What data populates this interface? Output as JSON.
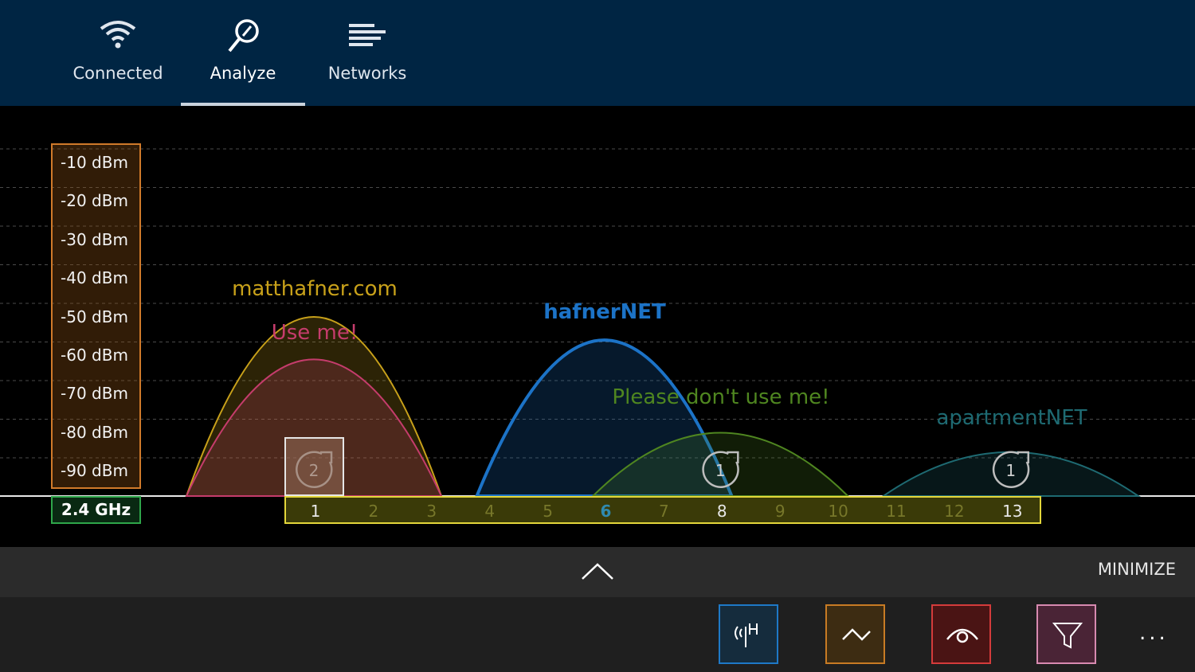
{
  "nav": {
    "tabs": [
      {
        "label": "Connected",
        "icon": "wifi-icon"
      },
      {
        "label": "Analyze",
        "icon": "magnifier-icon",
        "active": true
      },
      {
        "label": "Networks",
        "icon": "list-icon"
      }
    ]
  },
  "analyzer": {
    "dbm_labels": [
      "-10 dBm",
      "-20 dBm",
      "-30 dBm",
      "-40 dBm",
      "-50 dBm",
      "-60 dBm",
      "-70 dBm",
      "-80 dBm",
      "-90 dBm"
    ],
    "band": "2.4 GHz",
    "channels": [
      "1",
      "2",
      "3",
      "4",
      "5",
      "6",
      "7",
      "8",
      "9",
      "10",
      "11",
      "12",
      "13"
    ],
    "highlighted_channels": {
      "1": "#e8e8e8",
      "6": "#2f8ab0",
      "8": "#e8e8e8",
      "13": "#e8e8e8"
    },
    "networks": [
      {
        "name": "matthafner.com",
        "channel": 1,
        "signal_dbm": -50,
        "color": "#c8a11a"
      },
      {
        "name": "Use me!",
        "channel": 1,
        "signal_dbm": -61,
        "color": "#c53c6c"
      },
      {
        "name": "hafnerNET",
        "channel": 6,
        "signal_dbm": -56,
        "color": "#1c73c7",
        "bold": true
      },
      {
        "name": "Please don't use me!",
        "channel": 8,
        "signal_dbm": -80,
        "color": "#4f8620"
      },
      {
        "name": "apartmentNET",
        "channel": 13,
        "signal_dbm": -85,
        "color": "#1e6a72"
      }
    ],
    "channel_badges": [
      {
        "channel": 1,
        "count": "2",
        "selected": true
      },
      {
        "channel": 8,
        "count": "1"
      },
      {
        "channel": 13,
        "count": "1"
      }
    ]
  },
  "bottom": {
    "minimize_label": "MINIMIZE",
    "more_label": "...",
    "buttons": [
      {
        "name": "hidden-networks",
        "icon": "antenna-icon",
        "color": "#1e79c7"
      },
      {
        "name": "trend",
        "icon": "zigzag-icon",
        "color": "#c87b24"
      },
      {
        "name": "visibility",
        "icon": "eye-icon",
        "color": "#d43b3b"
      },
      {
        "name": "filter",
        "icon": "filter-icon",
        "color": "#d78ab0"
      }
    ]
  }
}
